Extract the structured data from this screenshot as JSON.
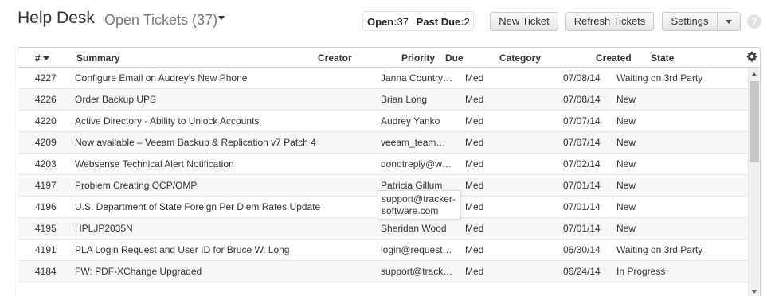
{
  "header": {
    "title": "Help Desk",
    "view_label": "Open Tickets (37)",
    "counts": {
      "open_label": "Open:",
      "open_value": "37",
      "pastdue_label": "Past Due:",
      "pastdue_value": "2"
    },
    "buttons": {
      "new_ticket": "New Ticket",
      "refresh": "Refresh Tickets",
      "settings": "Settings"
    },
    "help_icon": "?"
  },
  "table": {
    "columns": {
      "num": "#",
      "summary": "Summary",
      "creator": "Creator",
      "priority": "Priority",
      "due": "Due",
      "category": "Category",
      "created": "Created",
      "state": "State"
    },
    "sort_column": "#",
    "rows": [
      {
        "num": "4227",
        "summary": "Configure Email on Audrey's New Phone",
        "creator": "Janna Country…",
        "priority": "Med",
        "category": "",
        "created": "07/08/14",
        "state": "Waiting on 3rd Party"
      },
      {
        "num": "4226",
        "summary": "Order Backup UPS",
        "creator": "Brian Long",
        "priority": "Med",
        "category": "",
        "created": "07/08/14",
        "state": "New"
      },
      {
        "num": "4220",
        "summary": "Active Directory - Ability to Unlock Accounts",
        "creator": "Audrey Yanko",
        "priority": "Med",
        "category": "",
        "created": "07/07/14",
        "state": "New"
      },
      {
        "num": "4209",
        "summary": "Now available – Veeam Backup & Replication v7 Patch 4",
        "creator": "veeam_team…",
        "priority": "Med",
        "category": "",
        "created": "07/07/14",
        "state": "New"
      },
      {
        "num": "4203",
        "summary": "Websense Technical Alert Notification",
        "creator": "donotreply@w…",
        "priority": "Med",
        "category": "",
        "created": "07/02/14",
        "state": "New"
      },
      {
        "num": "4197",
        "summary": "Problem Creating OCP/OMP",
        "creator": "Patricia Gillum",
        "priority": "Med",
        "category": "",
        "created": "07/01/14",
        "state": "New"
      },
      {
        "num": "4196",
        "summary": "U.S. Department of State Foreign Per Diem Rates Update",
        "creator": "",
        "priority": "Med",
        "category": "",
        "created": "07/01/14",
        "state": "New"
      },
      {
        "num": "4195",
        "summary": "HPLJP2035N",
        "creator": "Sheridan Wood",
        "priority": "Med",
        "category": "",
        "created": "07/01/14",
        "state": "New"
      },
      {
        "num": "4191",
        "summary": "PLA Login Request and User ID for Bruce W. Long",
        "creator": "login@request…",
        "priority": "Med",
        "category": "",
        "created": "06/30/14",
        "state": "Waiting on 3rd Party"
      },
      {
        "num": "4184",
        "summary": "FW: PDF-XChange Upgraded",
        "creator": "support@track…",
        "priority": "Med",
        "category": "",
        "created": "06/24/14",
        "state": "In Progress"
      }
    ],
    "tooltip": "support@tracker-\nsoftware.com"
  },
  "icons": [
    "caret-down-icon",
    "gear-icon",
    "help-icon",
    "scroll-up-icon",
    "scroll-down-icon"
  ]
}
